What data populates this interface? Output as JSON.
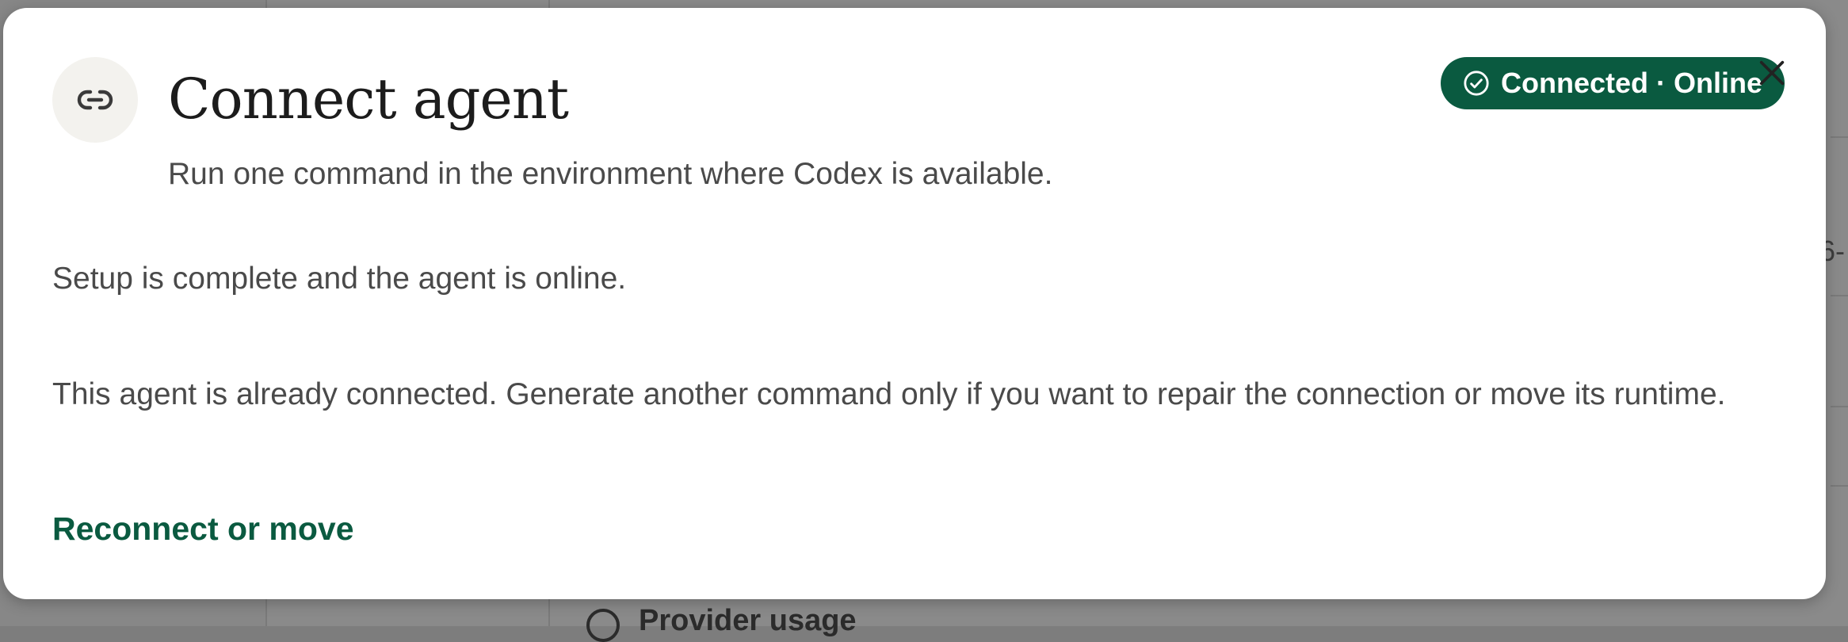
{
  "dialog": {
    "title": "Connect agent",
    "subtitle": "Run one command in the environment where Codex is available.",
    "status_badge": "Connected · Online",
    "status_message": "Setup is complete and the agent is online.",
    "info_message": "This agent is already connected. Generate another command only if you want to repair the connection or move its runtime.",
    "action_link": "Reconnect or move",
    "icons": {
      "header": "link-icon",
      "badge": "check-circle-icon",
      "close": "close-icon"
    }
  },
  "background": {
    "fragment_text": "6-",
    "bottom_item_label": "Provider usage"
  },
  "colors": {
    "accent": "#0a5a40",
    "icon_bg": "#f3f2ee",
    "text": "#4a4a4a",
    "title": "#1c1c1c",
    "overlay": "#8a8a8a"
  }
}
